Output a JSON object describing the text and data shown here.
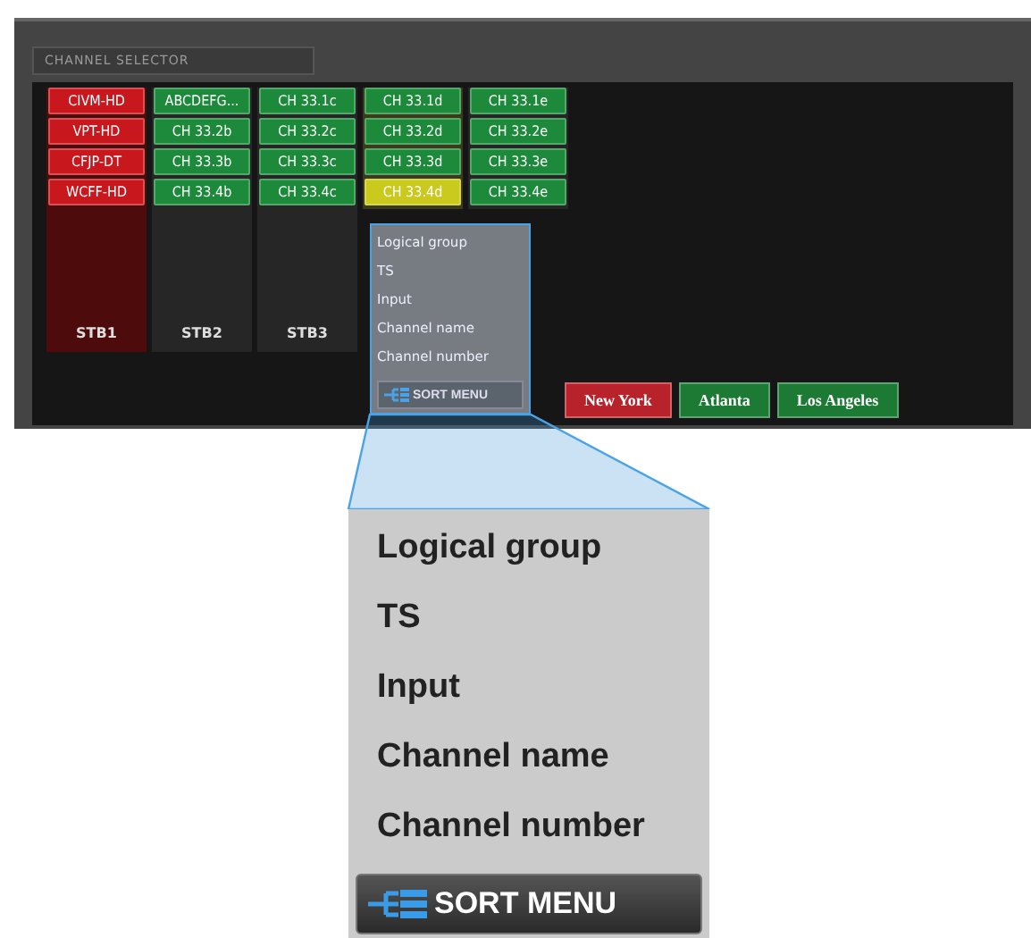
{
  "panel_title": "CHANNEL SELECTOR",
  "stbs": [
    {
      "label": "STB1",
      "color": "#4e0b0b",
      "channels": [
        {
          "name": "CIVM-HD",
          "color": "#c8181e"
        },
        {
          "name": "VPT-HD",
          "color": "#c8181e"
        },
        {
          "name": "CFJP-DT",
          "color": "#c8181e"
        },
        {
          "name": "WCFF-HD",
          "color": "#c8181e"
        }
      ]
    },
    {
      "label": "STB2",
      "color": "#262626",
      "channels": [
        {
          "name": "ABCDEFG...",
          "color": "#1c8a3a"
        },
        {
          "name": "CH 33.2b",
          "color": "#1c8a3a"
        },
        {
          "name": "CH 33.3b",
          "color": "#1c8a3a"
        },
        {
          "name": "CH 33.4b",
          "color": "#1c8a3a"
        }
      ]
    },
    {
      "label": "STB3",
      "color": "#262626",
      "channels": [
        {
          "name": "CH 33.1c",
          "color": "#1c8a3a"
        },
        {
          "name": "CH 33.2c",
          "color": "#1c8a3a"
        },
        {
          "name": "CH 33.3c",
          "color": "#1c8a3a"
        },
        {
          "name": "CH 33.4c",
          "color": "#1c8a3a"
        }
      ]
    },
    {
      "color": "#3b3b1c",
      "channels": [
        {
          "name": "CH 33.1d",
          "color": "#1c8a3a"
        },
        {
          "name": "CH 33.2d",
          "color": "#1c8a3a"
        },
        {
          "name": "CH 33.3d",
          "color": "#1c8a3a"
        },
        {
          "name": "CH 33.4d",
          "color": "#c9c91e"
        }
      ]
    },
    {
      "color": "#262626",
      "channels": [
        {
          "name": "CH 33.1e",
          "color": "#1c8a3a"
        },
        {
          "name": "CH 33.2e",
          "color": "#1c8a3a"
        },
        {
          "name": "CH 33.3e",
          "color": "#1c8a3a"
        },
        {
          "name": "CH 33.4e",
          "color": "#1c8a3a"
        }
      ]
    }
  ],
  "locations": [
    {
      "label": "New York",
      "color": "#b8232b"
    },
    {
      "label": "Atlanta",
      "color": "#1c7a34"
    },
    {
      "label": "Los Angeles",
      "color": "#1c7a34"
    }
  ],
  "sort_menu": {
    "items": [
      "Logical group",
      "TS",
      "Input",
      "Channel name",
      "Channel number"
    ],
    "button": "SORT MENU"
  },
  "zoomed_sort_menu": {
    "items": [
      "Logical group",
      "TS",
      "Input",
      "Channel name",
      "Channel number"
    ],
    "button": "SORT MENU"
  }
}
